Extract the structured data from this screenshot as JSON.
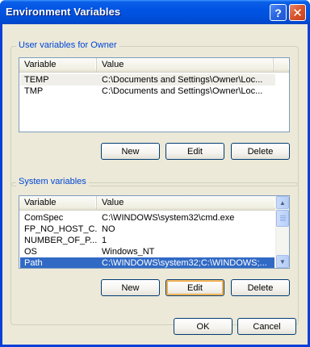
{
  "window": {
    "title": "Environment Variables",
    "help_glyph": "?",
    "close_glyph": "✕"
  },
  "user_vars": {
    "label": "User variables for Owner",
    "columns": [
      "Variable",
      "Value"
    ],
    "rows": [
      {
        "variable": "TEMP",
        "value": "C:\\Documents and Settings\\Owner\\Loc..."
      },
      {
        "variable": "TMP",
        "value": "C:\\Documents and Settings\\Owner\\Loc..."
      }
    ],
    "buttons": {
      "new": "New",
      "edit": "Edit",
      "delete": "Delete"
    }
  },
  "system_vars": {
    "label": "System variables",
    "columns": [
      "Variable",
      "Value"
    ],
    "rows": [
      {
        "variable": "ComSpec",
        "value": "C:\\WINDOWS\\system32\\cmd.exe"
      },
      {
        "variable": "FP_NO_HOST_C...",
        "value": "NO"
      },
      {
        "variable": "NUMBER_OF_P...",
        "value": "1"
      },
      {
        "variable": "OS",
        "value": "Windows_NT"
      },
      {
        "variable": "Path",
        "value": "C:\\WINDOWS\\system32;C:\\WINDOWS;..."
      }
    ],
    "buttons": {
      "new": "New",
      "edit": "Edit",
      "delete": "Delete"
    },
    "scroll_up_glyph": "▲",
    "scroll_down_glyph": "▼"
  },
  "dialog_buttons": {
    "ok": "OK",
    "cancel": "Cancel"
  },
  "colors": {
    "titlebar": "#0054e3",
    "dialog_bg": "#ece9d8",
    "selection": "#316ac5",
    "group_label": "#0046d5"
  }
}
